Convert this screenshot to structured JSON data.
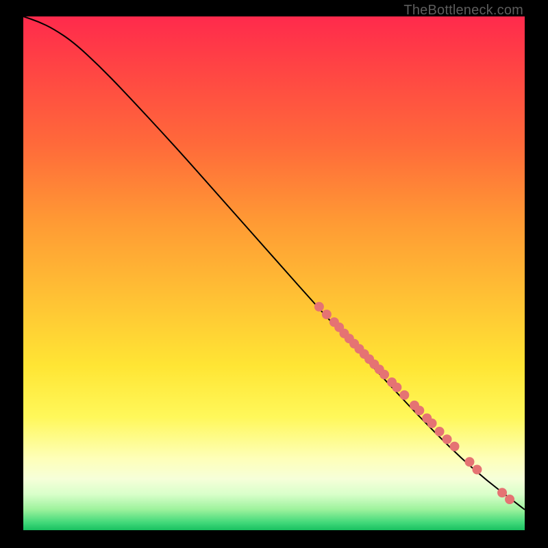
{
  "attribution": "TheBottleneck.com",
  "colors": {
    "marker": "#e57373",
    "line": "#000000",
    "gradient_top": "#ff2a4c",
    "gradient_bottom": "#18c060"
  },
  "chart_data": {
    "type": "line",
    "title": "",
    "xlabel": "",
    "ylabel": "",
    "xlim": [
      0,
      100
    ],
    "ylim": [
      0,
      100
    ],
    "grid": false,
    "legend": false,
    "annotations": [],
    "curve": [
      {
        "x": 0,
        "y": 100.0
      },
      {
        "x": 3,
        "y": 99.0
      },
      {
        "x": 6,
        "y": 97.6
      },
      {
        "x": 10,
        "y": 95.0
      },
      {
        "x": 15,
        "y": 90.5
      },
      {
        "x": 20,
        "y": 85.5
      },
      {
        "x": 30,
        "y": 75.0
      },
      {
        "x": 40,
        "y": 64.0
      },
      {
        "x": 50,
        "y": 53.0
      },
      {
        "x": 60,
        "y": 42.0
      },
      {
        "x": 70,
        "y": 31.5
      },
      {
        "x": 80,
        "y": 21.0
      },
      {
        "x": 90,
        "y": 11.5
      },
      {
        "x": 100,
        "y": 4.0
      }
    ],
    "series": [
      {
        "name": "highlighted-points",
        "points": [
          {
            "x": 59.0,
            "y": 43.5
          },
          {
            "x": 60.5,
            "y": 42.0
          },
          {
            "x": 62.0,
            "y": 40.5
          },
          {
            "x": 63.0,
            "y": 39.5
          },
          {
            "x": 64.0,
            "y": 38.3
          },
          {
            "x": 65.0,
            "y": 37.3
          },
          {
            "x": 66.0,
            "y": 36.3
          },
          {
            "x": 67.0,
            "y": 35.3
          },
          {
            "x": 68.0,
            "y": 34.3
          },
          {
            "x": 69.0,
            "y": 33.3
          },
          {
            "x": 70.0,
            "y": 32.3
          },
          {
            "x": 71.0,
            "y": 31.3
          },
          {
            "x": 72.0,
            "y": 30.3
          },
          {
            "x": 73.5,
            "y": 28.8
          },
          {
            "x": 74.5,
            "y": 27.8
          },
          {
            "x": 76.0,
            "y": 26.3
          },
          {
            "x": 78.0,
            "y": 24.3
          },
          {
            "x": 79.0,
            "y": 23.3
          },
          {
            "x": 80.5,
            "y": 21.8
          },
          {
            "x": 81.5,
            "y": 20.8
          },
          {
            "x": 83.0,
            "y": 19.2
          },
          {
            "x": 84.5,
            "y": 17.7
          },
          {
            "x": 86.0,
            "y": 16.3
          },
          {
            "x": 89.0,
            "y": 13.3
          },
          {
            "x": 90.5,
            "y": 11.8
          },
          {
            "x": 95.5,
            "y": 7.3
          },
          {
            "x": 97.0,
            "y": 6.0
          }
        ]
      }
    ]
  }
}
